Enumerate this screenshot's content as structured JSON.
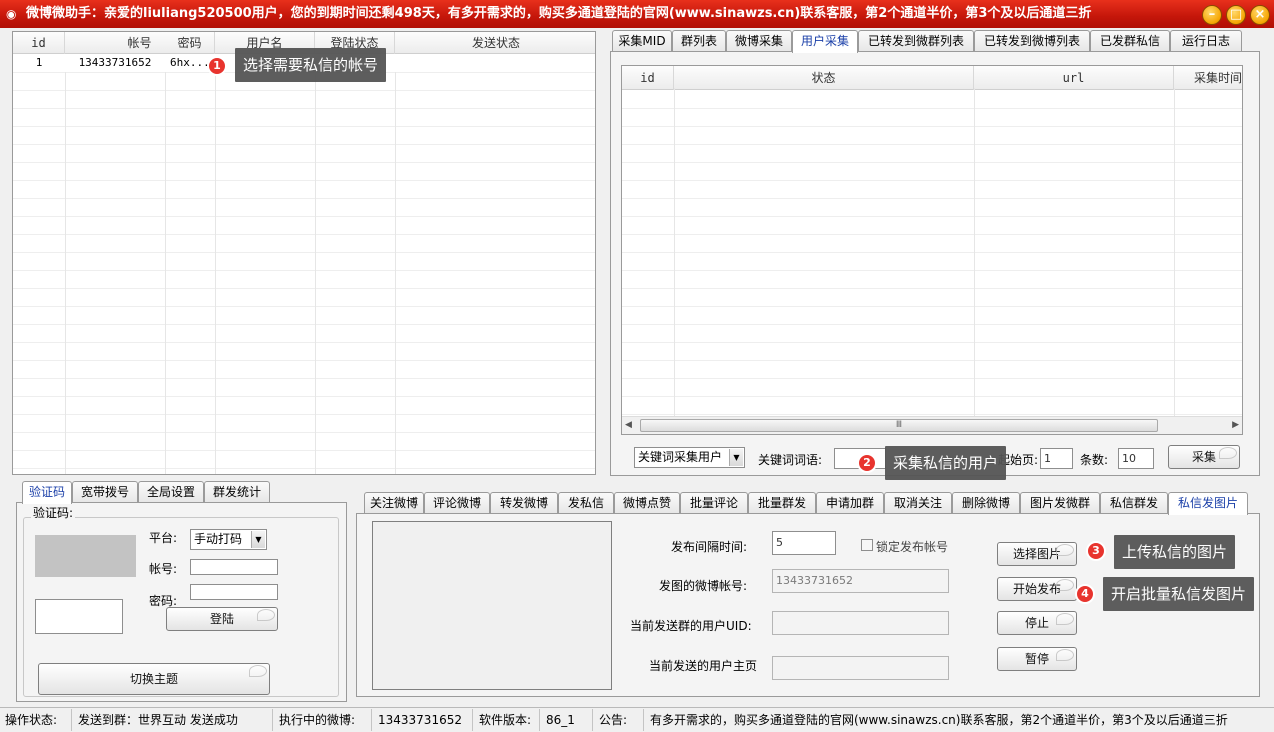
{
  "window": {
    "title": "微博微助手：亲爱的liuliang520500用户，您的到期时间还剩498天，有多开需求的，购买多通道登陆的官网(www.sinawzs.cn)联系客服，第2个通道半价，第3个及以后通道三折"
  },
  "account_grid": {
    "columns": [
      "id",
      "帐号",
      "密码",
      "用户名",
      "登陆状态",
      "发送状态"
    ],
    "rows": [
      {
        "id": "1",
        "account": "13433731652",
        "password": "6hx...",
        "username": "",
        "login_status": "",
        "send_status": ""
      }
    ]
  },
  "right_tabs": [
    "采集MID",
    "群列表",
    "微博采集",
    "用户采集",
    "已转发到微群列表",
    "已转发到微博列表",
    "已发群私信",
    "运行日志"
  ],
  "right_active_tab": "用户采集",
  "user_grid": {
    "columns": [
      "id",
      "状态",
      "url",
      "采集时间"
    ]
  },
  "collect_bar": {
    "mode_select": "关键词采集用户",
    "keyword_label": "关键词词语:",
    "keyword_value": "",
    "start_page_label": "起始页:",
    "start_page_value": "1",
    "count_label": "条数:",
    "count_value": "10",
    "collect_button": "采集"
  },
  "left_bottom_tabs": [
    "验证码",
    "宽带拨号",
    "全局设置",
    "群发统计"
  ],
  "left_bottom_active": "验证码",
  "captcha_panel": {
    "group_label": "验证码:",
    "platform_label": "平台:",
    "platform_value": "手动打码",
    "account_label": "帐号:",
    "password_label": "密码:",
    "login_button": "登陆",
    "switch_theme_button": "切换主题"
  },
  "bottom_tabs": [
    "关注微博",
    "评论微博",
    "转发微博",
    "发私信",
    "微博点赞",
    "批量评论",
    "批量群发",
    "申请加群",
    "取消关注",
    "删除微博",
    "图片发微群",
    "私信群发",
    "私信发图片"
  ],
  "bottom_active_tab": "私信发图片",
  "dm_image_panel": {
    "interval_label": "发布间隔时间:",
    "interval_value": "5",
    "lock_account_label": "锁定发布帐号",
    "account_label": "发图的微博帐号:",
    "account_value": "13433731652",
    "current_uid_label": "当前发送群的用户UID:",
    "current_uid_value": "",
    "current_home_label": "当前发送的用户主页",
    "current_home_value": "",
    "choose_image_button": "选择图片",
    "start_button": "开始发布",
    "stop_button": "停止",
    "pause_button": "暂停"
  },
  "annotations": [
    {
      "num": "1",
      "text": "选择需要私信的帐号"
    },
    {
      "num": "2",
      "text": "采集私信的用户"
    },
    {
      "num": "3",
      "text": "上传私信的图片"
    },
    {
      "num": "4",
      "text": "开启批量私信发图片"
    }
  ],
  "status_bar": {
    "op_label": "操作状态:",
    "op_value": "发送到群：世界互动 发送成功",
    "weibo_label": "执行中的微博:",
    "weibo_value": "13433731652",
    "version_label": "软件版本:",
    "version_value": "86_1",
    "notice_label": "公告:",
    "notice_value": "有多开需求的，购买多通道登陆的官网(www.sinawzs.cn)联系客服，第2个通道半价，第3个及以后通道三折"
  },
  "colors": {
    "title_bar": "#c4160a",
    "active_tab_text": "#1a3fa8",
    "badge": "#e8342e",
    "annotation_bg": "#555555"
  }
}
